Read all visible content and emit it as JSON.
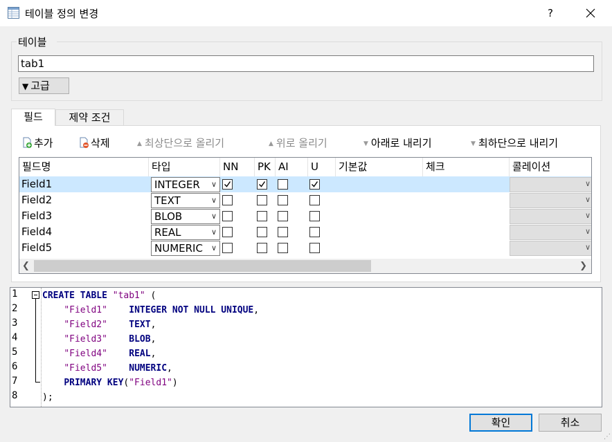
{
  "window": {
    "title": "테이블 정의 변경",
    "help_label": "?"
  },
  "table_group": {
    "label": "테이블",
    "name_value": "tab1",
    "advanced_label": "고급"
  },
  "tabs": [
    {
      "label": "필드"
    },
    {
      "label": "제약 조건"
    }
  ],
  "toolbar": {
    "add": "추가",
    "delete": "삭제",
    "move_top": "최상단으로 올리기",
    "move_up": "위로 올리기",
    "move_down": "아래로 내리기",
    "move_bottom": "최하단으로 내리기"
  },
  "grid": {
    "columns": [
      "필드명",
      "타입",
      "NN",
      "PK",
      "AI",
      "U",
      "기본값",
      "체크",
      "콜레이션"
    ],
    "rows": [
      {
        "name": "Field1",
        "type": "INTEGER",
        "nn": true,
        "pk": true,
        "ai": false,
        "u": true,
        "selected": true
      },
      {
        "name": "Field2",
        "type": "TEXT",
        "nn": false,
        "pk": false,
        "ai": false,
        "u": false,
        "selected": false
      },
      {
        "name": "Field3",
        "type": "BLOB",
        "nn": false,
        "pk": false,
        "ai": false,
        "u": false,
        "selected": false
      },
      {
        "name": "Field4",
        "type": "REAL",
        "nn": false,
        "pk": false,
        "ai": false,
        "u": false,
        "selected": false
      },
      {
        "name": "Field5",
        "type": "NUMERIC",
        "nn": false,
        "pk": false,
        "ai": false,
        "u": false,
        "selected": false
      }
    ]
  },
  "sql": {
    "line_numbers": [
      "1",
      "2",
      "3",
      "4",
      "5",
      "6",
      "7",
      "8"
    ],
    "lines": [
      [
        {
          "t": "CREATE TABLE ",
          "c": "kw"
        },
        {
          "t": "\"tab1\"",
          "c": "str"
        },
        {
          "t": " (",
          "c": ""
        }
      ],
      [
        {
          "t": "    ",
          "c": ""
        },
        {
          "t": "\"Field1\"",
          "c": "str"
        },
        {
          "t": "    ",
          "c": ""
        },
        {
          "t": "INTEGER NOT NULL UNIQUE",
          "c": "kw"
        },
        {
          "t": ",",
          "c": ""
        }
      ],
      [
        {
          "t": "    ",
          "c": ""
        },
        {
          "t": "\"Field2\"",
          "c": "str"
        },
        {
          "t": "    ",
          "c": ""
        },
        {
          "t": "TEXT",
          "c": "kw"
        },
        {
          "t": ",",
          "c": ""
        }
      ],
      [
        {
          "t": "    ",
          "c": ""
        },
        {
          "t": "\"Field3\"",
          "c": "str"
        },
        {
          "t": "    ",
          "c": ""
        },
        {
          "t": "BLOB",
          "c": "kw"
        },
        {
          "t": ",",
          "c": ""
        }
      ],
      [
        {
          "t": "    ",
          "c": ""
        },
        {
          "t": "\"Field4\"",
          "c": "str"
        },
        {
          "t": "    ",
          "c": ""
        },
        {
          "t": "REAL",
          "c": "kw"
        },
        {
          "t": ",",
          "c": ""
        }
      ],
      [
        {
          "t": "    ",
          "c": ""
        },
        {
          "t": "\"Field5\"",
          "c": "str"
        },
        {
          "t": "    ",
          "c": ""
        },
        {
          "t": "NUMERIC",
          "c": "kw"
        },
        {
          "t": ",",
          "c": ""
        }
      ],
      [
        {
          "t": "    ",
          "c": ""
        },
        {
          "t": "PRIMARY KEY",
          "c": "kw"
        },
        {
          "t": "(",
          "c": ""
        },
        {
          "t": "\"Field1\"",
          "c": "str"
        },
        {
          "t": ")",
          "c": ""
        }
      ],
      [
        {
          "t": ");",
          "c": ""
        }
      ]
    ]
  },
  "buttons": {
    "ok": "확인",
    "cancel": "취소"
  },
  "colors": {
    "selection": "#cce8ff",
    "keyword": "#00007f",
    "string": "#7f007f",
    "primary_border": "#0078d7"
  }
}
